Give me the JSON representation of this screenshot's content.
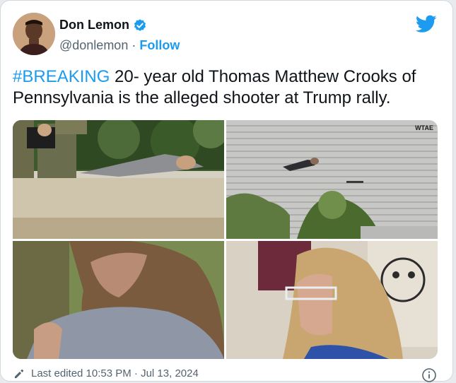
{
  "author": {
    "display_name": "Don Lemon",
    "handle": "@donlemon",
    "separator": "·",
    "follow_label": "Follow"
  },
  "icons": {
    "verified": "verified-badge-icon",
    "brand": "twitter-bird-icon",
    "edit": "pencil-icon",
    "info": "info-icon"
  },
  "tweet": {
    "hashtag": "#BREAKING",
    "line1_rest": " 20- year old Thomas Matthew Crooks of",
    "line2": "Pennsylvania is the alleged shooter at Trump rally."
  },
  "media": {
    "photo2_watermark": "WTAE"
  },
  "footer": {
    "edited_text": "Last edited 10:53 PM · Jul 13, 2024"
  },
  "colors": {
    "accent": "#1d9bf0",
    "text": "#0f1419",
    "secondary": "#536471"
  }
}
